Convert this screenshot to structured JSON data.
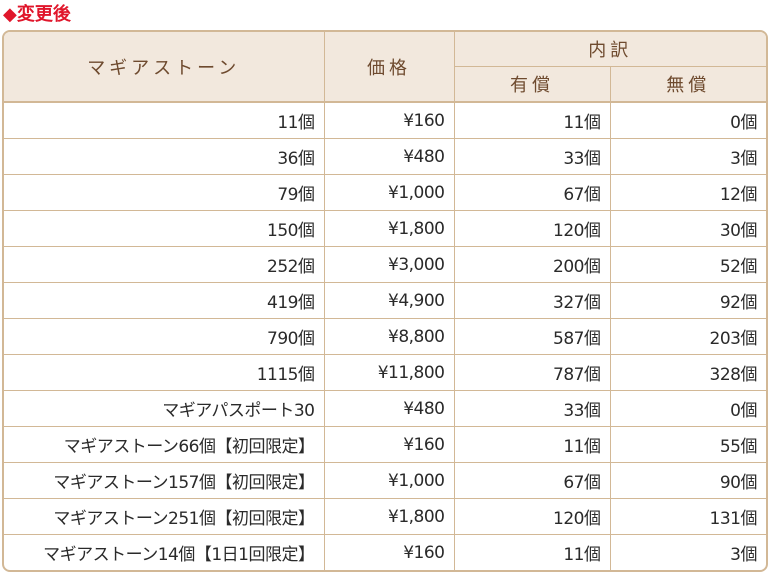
{
  "heading": "◆変更後",
  "table": {
    "header": {
      "col_stone": "マギアストーン",
      "col_price": "価格",
      "col_breakdown": "内訳",
      "col_paid": "有償",
      "col_free": "無償"
    },
    "rows": [
      {
        "stone": "11個",
        "price": "¥160",
        "paid": "11個",
        "free": "0個"
      },
      {
        "stone": "36個",
        "price": "¥480",
        "paid": "33個",
        "free": "3個"
      },
      {
        "stone": "79個",
        "price": "¥1,000",
        "paid": "67個",
        "free": "12個"
      },
      {
        "stone": "150個",
        "price": "¥1,800",
        "paid": "120個",
        "free": "30個"
      },
      {
        "stone": "252個",
        "price": "¥3,000",
        "paid": "200個",
        "free": "52個"
      },
      {
        "stone": "419個",
        "price": "¥4,900",
        "paid": "327個",
        "free": "92個"
      },
      {
        "stone": "790個",
        "price": "¥8,800",
        "paid": "587個",
        "free": "203個"
      },
      {
        "stone": "1115個",
        "price": "¥11,800",
        "paid": "787個",
        "free": "328個"
      },
      {
        "stone": "マギアパスポート30",
        "price": "¥480",
        "paid": "33個",
        "free": "0個"
      },
      {
        "stone": "マギアストーン66個【初回限定】",
        "price": "¥160",
        "paid": "11個",
        "free": "55個"
      },
      {
        "stone": "マギアストーン157個【初回限定】",
        "price": "¥1,000",
        "paid": "67個",
        "free": "90個"
      },
      {
        "stone": "マギアストーン251個【初回限定】",
        "price": "¥1,800",
        "paid": "120個",
        "free": "131個"
      },
      {
        "stone": "マギアストーン14個【1日1回限定】",
        "price": "¥160",
        "paid": "11個",
        "free": "3個"
      }
    ]
  }
}
